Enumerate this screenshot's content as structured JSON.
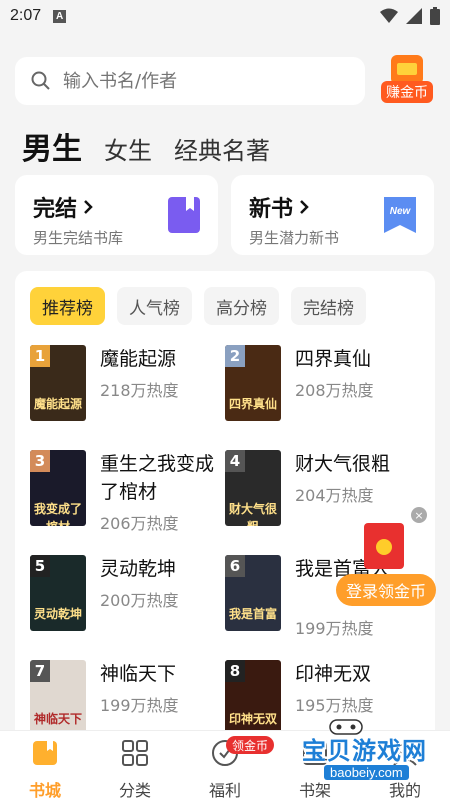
{
  "status": {
    "time": "2:07",
    "a": "A"
  },
  "search": {
    "placeholder": "输入书名/作者"
  },
  "coin_button": {
    "label": "赚金币"
  },
  "gender_tabs": [
    "男生",
    "女生",
    "经典名著"
  ],
  "cards": [
    {
      "title": "完结",
      "sub": "男生完结书库",
      "icon": "book-icon",
      "color": "#7a5cf0"
    },
    {
      "title": "新书",
      "sub": "男生潜力新书",
      "icon": "new-icon",
      "color": "#5b8df2",
      "icon_text": "New"
    }
  ],
  "rank_tabs": [
    "推荐榜",
    "人气榜",
    "高分榜",
    "完结榜"
  ],
  "books": [
    {
      "rank": "1",
      "name": "魔能起源",
      "heat": "218万热度",
      "rank_color": "#e8a23a",
      "cover_bg": "#3a2a1a",
      "cover_text": "魔能起源"
    },
    {
      "rank": "2",
      "name": "四界真仙",
      "heat": "208万热度",
      "rank_color": "#8aa0c0",
      "cover_bg": "#4a2a14",
      "cover_text": "四界真仙"
    },
    {
      "rank": "3",
      "name": "重生之我变成了棺材",
      "heat": "206万热度",
      "rank_color": "#d38b5a",
      "cover_bg": "#1a1a2a",
      "cover_text": "我变成了棺材"
    },
    {
      "rank": "4",
      "name": "财大气很粗",
      "heat": "204万热度",
      "rank_color": "#555555",
      "cover_bg": "#2a2a2a",
      "cover_text": "财大气很粗"
    },
    {
      "rank": "5",
      "name": "灵动乾坤",
      "heat": "200万热度",
      "rank_color": "#222222",
      "cover_bg": "#1a2a2a",
      "cover_text": "灵动乾坤"
    },
    {
      "rank": "6",
      "name": "我是首富人",
      "heat": "199万热度",
      "rank_color": "#555555",
      "cover_bg": "#2a3040",
      "cover_text": "我是首富"
    },
    {
      "rank": "7",
      "name": "神临天下",
      "heat": "199万热度",
      "rank_color": "#555555",
      "cover_bg": "#e0d8d0",
      "cover_text": "神临天下"
    },
    {
      "rank": "8",
      "name": "印神无双",
      "heat": "195万热度",
      "rank_color": "#222222",
      "cover_bg": "#3a1a10",
      "cover_text": "印神无双"
    }
  ],
  "promo": {
    "login_coin": "登录领金币",
    "close": "×"
  },
  "bottom_nav": [
    {
      "label": "书城",
      "icon": "bookstore-icon"
    },
    {
      "label": "分类",
      "icon": "category-icon"
    },
    {
      "label": "福利",
      "icon": "welfare-icon"
    },
    {
      "label": "书架",
      "icon": "bookshelf-icon"
    },
    {
      "label": "我的",
      "icon": "profile-icon"
    }
  ],
  "nav_badge": "领金币",
  "watermark": {
    "title": "宝贝游戏网",
    "url": "baobeiy.com"
  },
  "colors": {
    "accent": "#ff9e2a",
    "active_tab": "#ffd23a",
    "red": "#e8302f"
  }
}
